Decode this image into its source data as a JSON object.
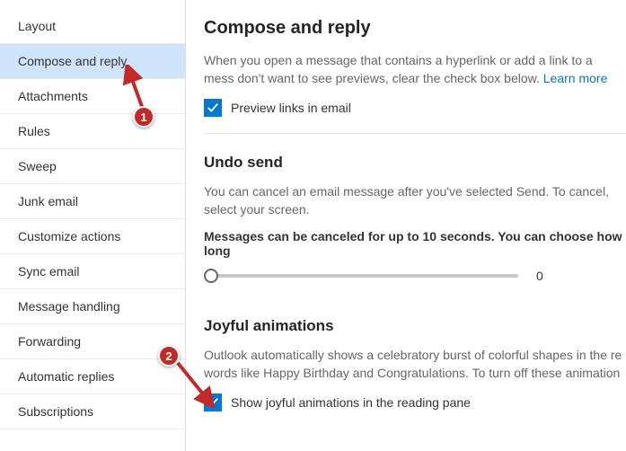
{
  "sidebar": {
    "items": [
      {
        "label": "Layout"
      },
      {
        "label": "Compose and reply"
      },
      {
        "label": "Attachments"
      },
      {
        "label": "Rules"
      },
      {
        "label": "Sweep"
      },
      {
        "label": "Junk email"
      },
      {
        "label": "Customize actions"
      },
      {
        "label": "Sync email"
      },
      {
        "label": "Message handling"
      },
      {
        "label": "Forwarding"
      },
      {
        "label": "Automatic replies"
      },
      {
        "label": "Subscriptions"
      }
    ]
  },
  "main": {
    "compose": {
      "title": "Compose and reply",
      "desc_a": "When you open a message that contains a hyperlink or add a link to a mess",
      "desc_b": "don't want to see previews, clear the check box below. ",
      "learn_more": "Learn more",
      "preview_label": "Preview links in email"
    },
    "undo": {
      "title": "Undo send",
      "desc": "You can cancel an email message after you've selected Send. To cancel, select your screen.",
      "bold": "Messages can be canceled for up to 10 seconds. You can choose how long",
      "value": "0"
    },
    "joyful": {
      "title": "Joyful animations",
      "desc": "Outlook automatically shows a celebratory burst of colorful shapes in the re words like Happy Birthday and Congratulations. To turn off these animation",
      "checkbox_label": "Show joyful animations in the reading pane"
    }
  },
  "annotations": {
    "badge1": "1",
    "badge2": "2"
  }
}
